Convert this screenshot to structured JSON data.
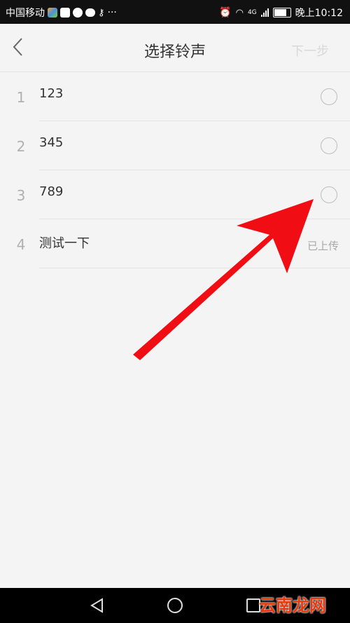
{
  "status_bar": {
    "carrier": "中国移动",
    "app_icons": [
      "photos-icon",
      "tiktok-icon",
      "camera-icon",
      "message-icon",
      "key-icon"
    ],
    "more": "···",
    "network": "4G",
    "time": "晚上10:12"
  },
  "header": {
    "title": "选择铃声",
    "next_label": "下一步"
  },
  "ringtones": [
    {
      "index": "1",
      "name": "123",
      "status": ""
    },
    {
      "index": "2",
      "name": "345",
      "status": ""
    },
    {
      "index": "3",
      "name": "789",
      "status": ""
    },
    {
      "index": "4",
      "name": "测试一下",
      "status": "已上传"
    }
  ],
  "watermark": "云南龙网",
  "colors": {
    "background": "#f4f4f4",
    "arrow": "#f10d14",
    "watermark": "#e8380d",
    "next_disabled": "#d8d8d8"
  }
}
